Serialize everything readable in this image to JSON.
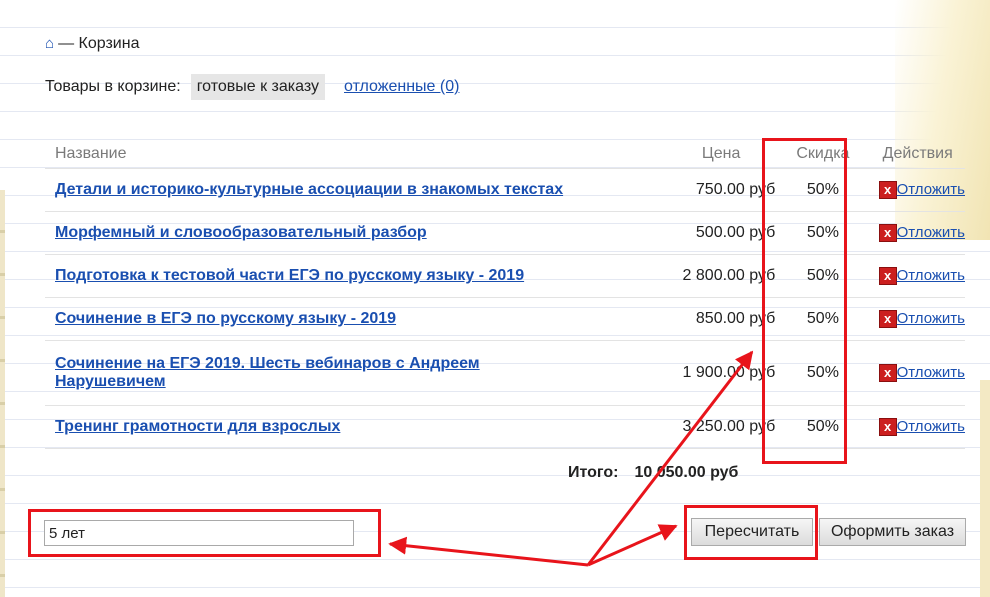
{
  "breadcrumb": {
    "home_icon": "home-icon",
    "separator": "—",
    "current": "Корзина"
  },
  "cart_tabs": {
    "label": "Товары в корзине:",
    "active": "готовые к заказу",
    "deferred": "отложенные (0)"
  },
  "table": {
    "headers": {
      "name": "Название",
      "price": "Цена",
      "discount": "Скидка",
      "actions": "Действия"
    },
    "rows": [
      {
        "name": "Детали и историко-культурные ассоциации в знакомых текстах",
        "price": "750.00 руб",
        "discount": "50%",
        "action": "Отложить"
      },
      {
        "name": "Морфемный и словообразовательный разбор",
        "price": "500.00 руб",
        "discount": "50%",
        "action": "Отложить"
      },
      {
        "name": "Подготовка к тестовой части ЕГЭ по русскому языку - 2019",
        "price": "2 800.00 руб",
        "discount": "50%",
        "action": "Отложить"
      },
      {
        "name": "Сочинение в ЕГЭ по русскому языку - 2019",
        "price": "850.00 руб",
        "discount": "50%",
        "action": "Отложить"
      },
      {
        "name": "Сочинение на ЕГЭ 2019. Шесть вебинаров с Андреем Нарушевичем",
        "price": "1 900.00 руб",
        "discount": "50%",
        "action": "Отложить"
      },
      {
        "name": "Тренинг грамотности для взрослых",
        "price": "3 250.00 руб",
        "discount": "50%",
        "action": "Отложить"
      }
    ],
    "delete_icon": "x"
  },
  "total": {
    "label": "Итого:",
    "value": "10 050.00 руб"
  },
  "promo": {
    "value": "5 лет"
  },
  "buttons": {
    "recalc": "Пересчитать",
    "order": "Оформить заказ"
  },
  "colors": {
    "link": "#1a4fb0",
    "highlight": "#e8141b",
    "delete_icon": "#cc1f1f"
  }
}
